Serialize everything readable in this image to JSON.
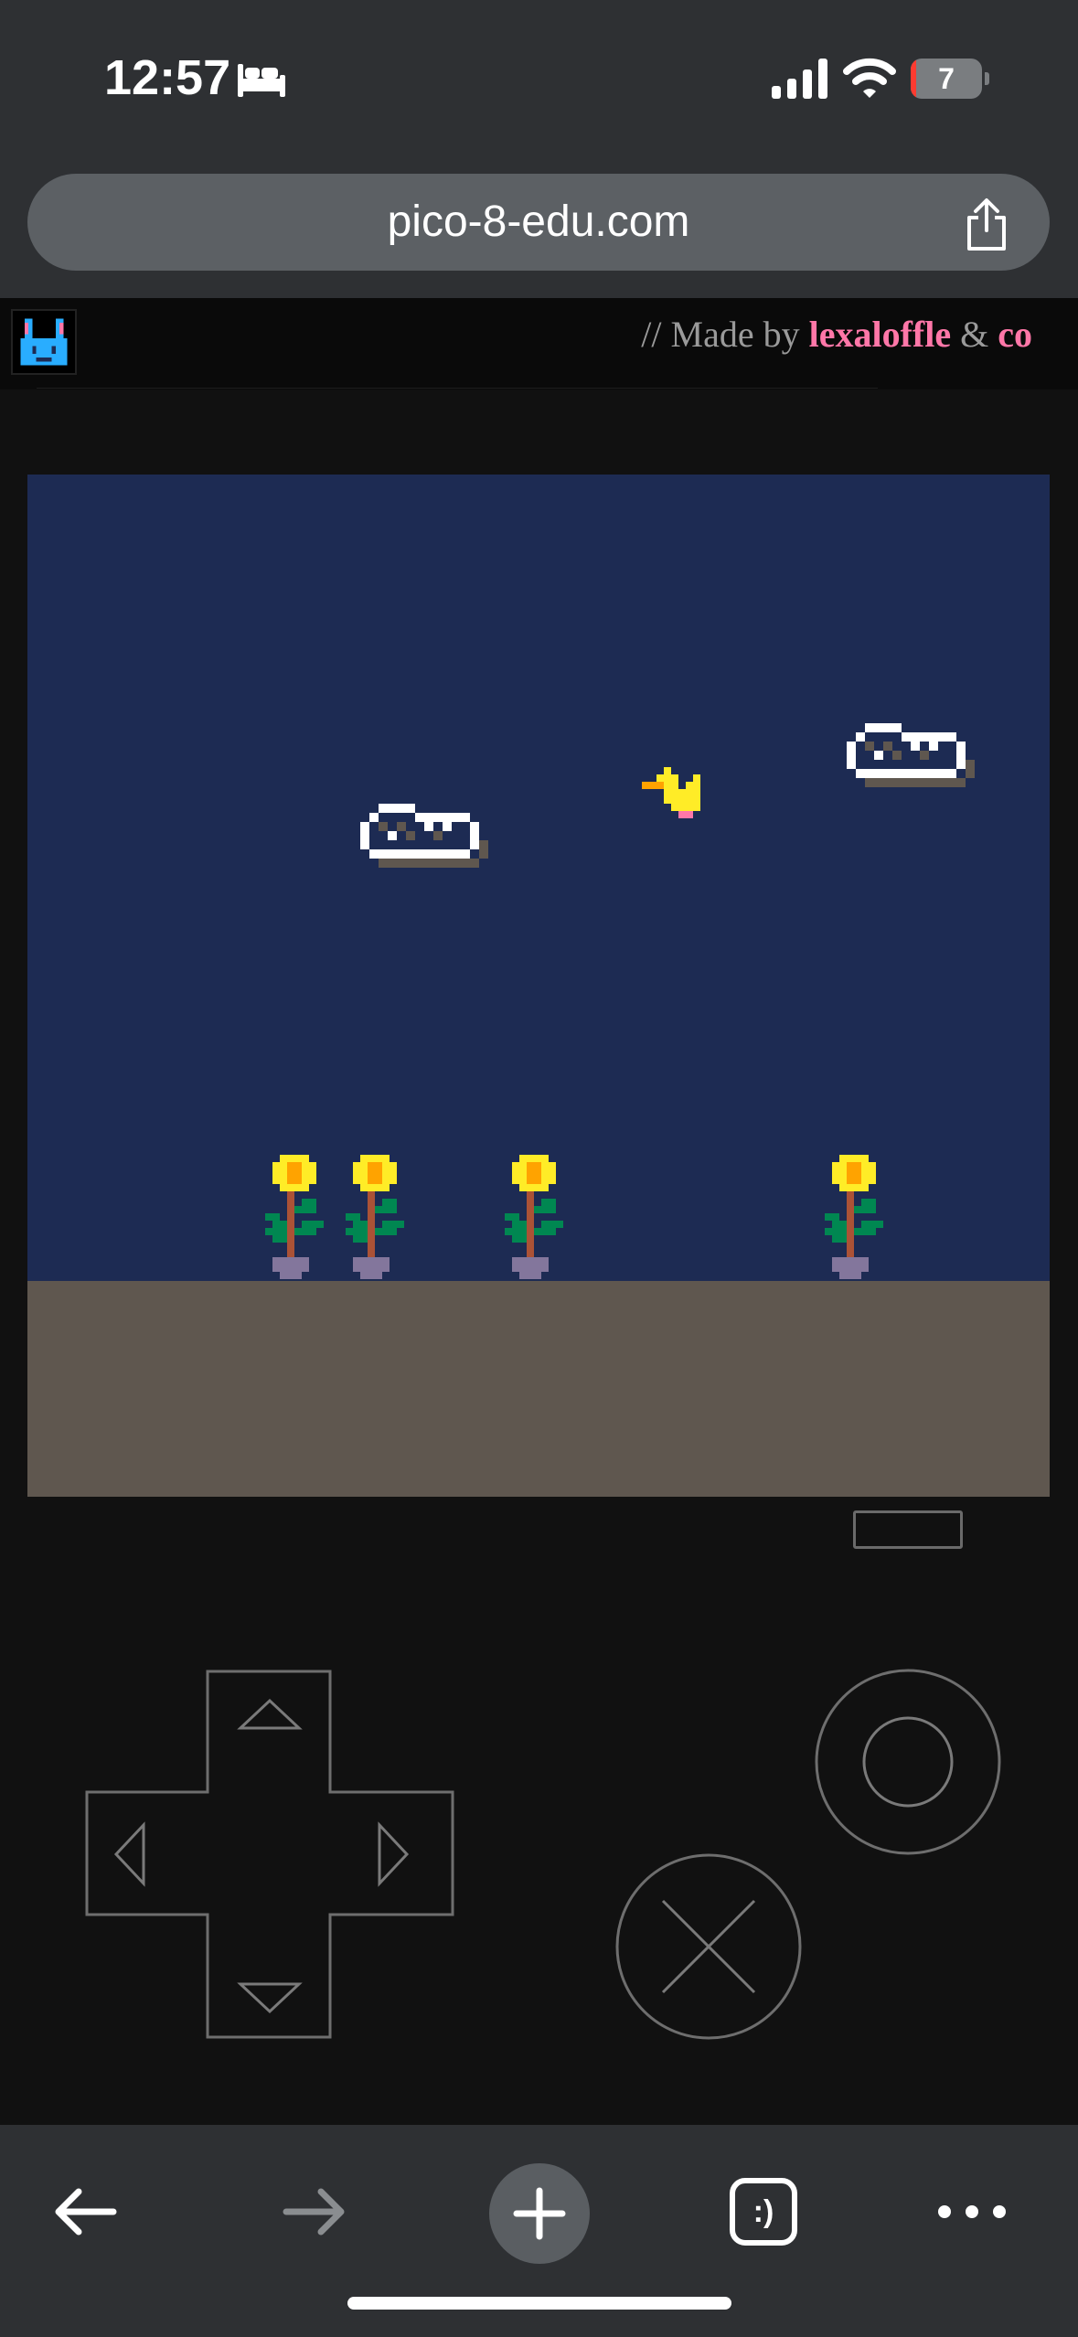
{
  "status_bar": {
    "time": "12:57",
    "battery_level": "7",
    "battery_percent": 7,
    "icons": [
      "bed-icon",
      "cellular-signal-icon",
      "wifi-icon",
      "battery-icon"
    ]
  },
  "browser": {
    "url": "pico-8-edu.com",
    "toolbar_icons": [
      "back-arrow-icon",
      "forward-arrow-icon",
      "new-tab-plus-icon",
      "tabs-icon",
      "more-icon"
    ],
    "tabs_icon_label": ":)"
  },
  "site_header": {
    "credit_prefix": "// Made by",
    "author": "lexaloffle",
    "amp": "&",
    "co": "co"
  },
  "game": {
    "sprites": [
      "cloud",
      "cloud",
      "bird",
      "sunflower",
      "sunflower",
      "sunflower",
      "sunflower"
    ],
    "colors": {
      "sky": "#1d2b53",
      "ground": "#5f574f",
      "petal": "#ffec27",
      "center": "#ffa300",
      "stem": "#ab5236",
      "leaf": "#008751",
      "pot": "#83769c",
      "bird": "#ffec27",
      "beak": "#ffa300",
      "feet": "#ff77a8",
      "cloud": "#ffffff"
    }
  },
  "controls": {
    "buttons": [
      "menu-button",
      "dpad-up",
      "dpad-down",
      "dpad-left",
      "dpad-right",
      "o-button",
      "x-button"
    ]
  }
}
